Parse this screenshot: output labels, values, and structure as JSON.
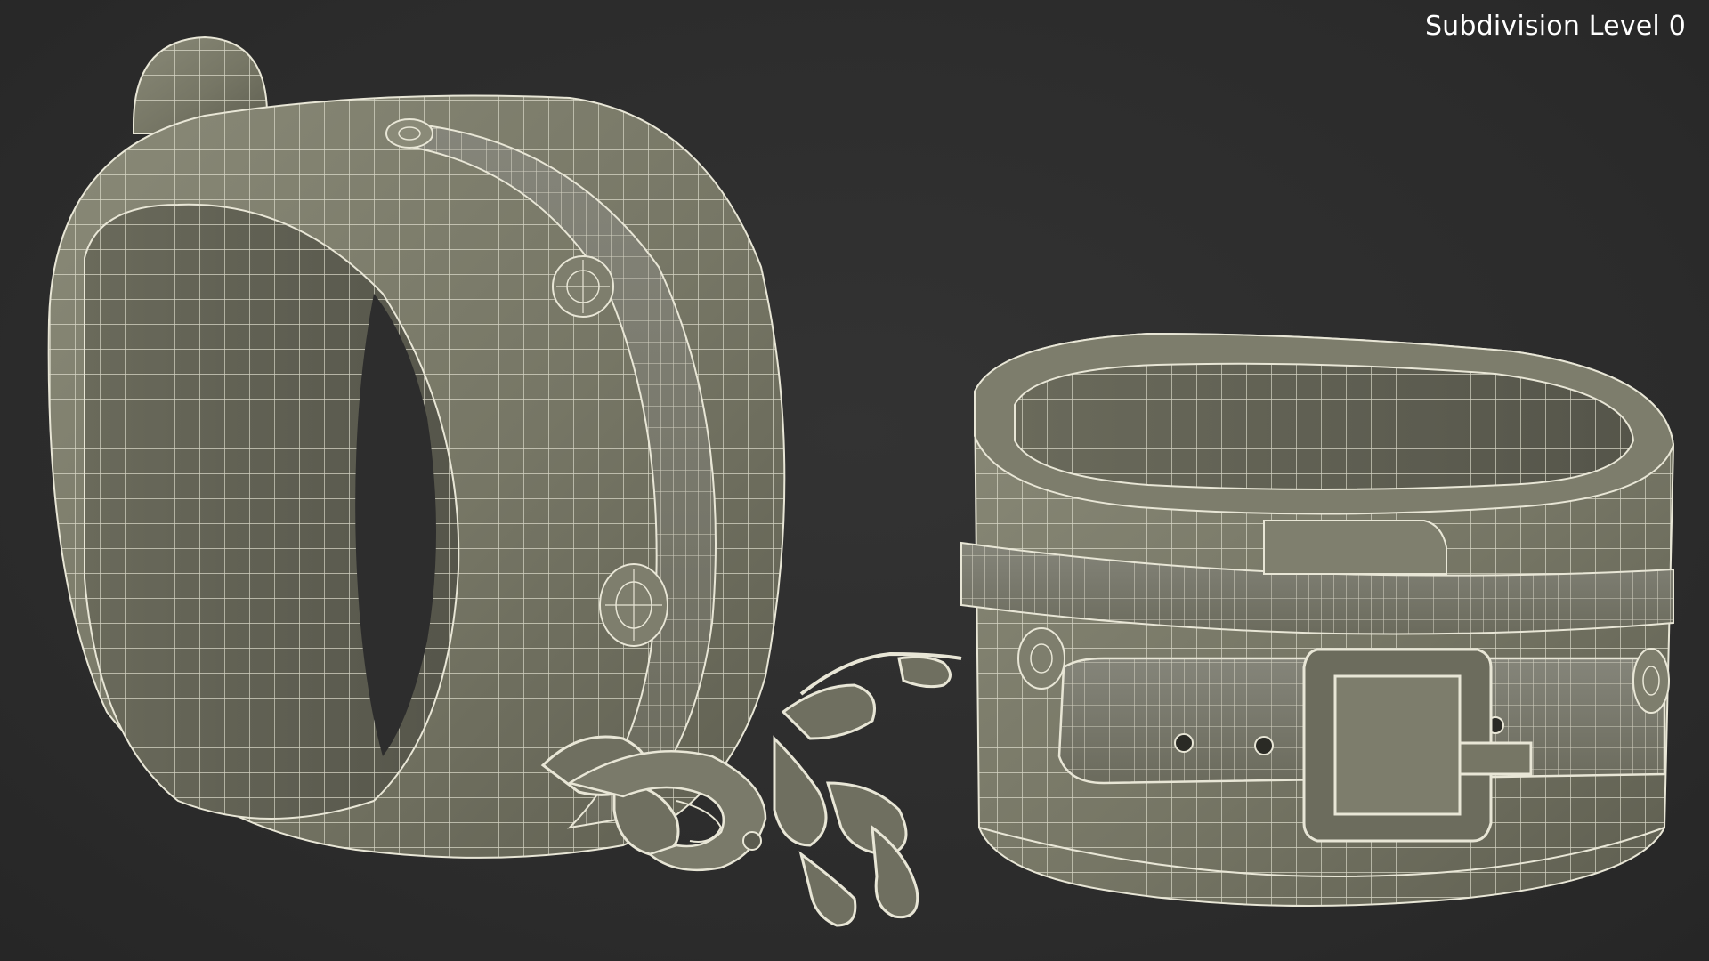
{
  "viewport": {
    "subdivision_label": "Subdivision Level 0"
  },
  "scene": {
    "background_color": "#2d2d2d",
    "mesh_fill_color": "#767665",
    "mesh_shadow_color": "#4f4f44",
    "mesh_highlight_color": "#8f8f7c",
    "wire_color": "#e8e6d6"
  }
}
